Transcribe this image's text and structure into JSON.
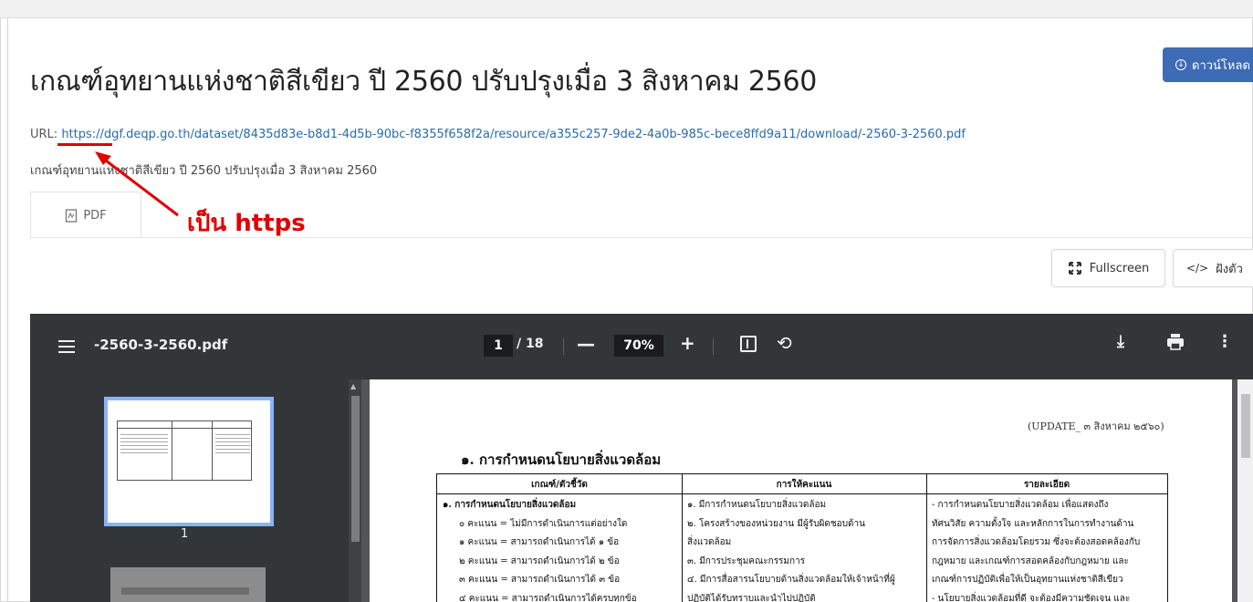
{
  "page": {
    "title": "เกณฑ์อุทยานแห่งชาติสีเขียว ปี 2560 ปรับปรุงเมื่อ 3 สิงหาคม 2560",
    "download_label": "ดาวน์โหลด",
    "url_label": "URL:",
    "url": "https://dgf.deqp.go.th/dataset/8435d83e-b8d1-4d5b-90bc-f8355f658f2a/resource/a355c257-9de2-4a0b-985c-bece8ffd9a11/download/-2560-3-2560.pdf",
    "description": "เกณฑ์อุทยานแห่งชาติสีเขียว ปี 2560 ปรับปรุงเมื่อ 3 สิงหาคม 2560",
    "tab_label": "PDF",
    "fullscreen_label": "Fullscreen",
    "embed_label": "ฝังตัว"
  },
  "annotation": {
    "text": "เป็น https",
    "color": "#e00000"
  },
  "viewer": {
    "filename": "-2560-3-2560.pdf",
    "current_page": "1",
    "total_pages": "/ 18",
    "zoom": "70%",
    "thumbnail_label": "1"
  },
  "document": {
    "update_note": "(UPDATE_ ๓ สิงหาคม ๒๕๖๐)",
    "heading": "๑. การกำหนดนโยบายสิ่งแวดล้อม",
    "table_headers": [
      "เกณฑ์/ตัวชี้วัด",
      "การให้คะแนน",
      "รายละเอียด"
    ],
    "col1": [
      "๑. การกำหนดนโยบายสิ่งแวดล้อม",
      "   ๐ คะแนน = ไม่มีการดำเนินการแต่อย่างใด",
      "   ๑ คะแนน = สามารถดำเนินการได้ ๑ ข้อ",
      "   ๒ คะแนน = สามารถดำเนินการได้ ๒ ข้อ",
      "   ๓ คะแนน = สามารถดำเนินการได้ ๓ ข้อ",
      "   ๔ คะแนน = สามารถดำเนินการได้ครบทุกข้อ"
    ],
    "col2": [
      "๑. มีการกำหนดนโยบายสิ่งแวดล้อม",
      "๒. โครงสร้างของหน่วยงาน มีผู้รับผิดชอบด้าน",
      "สิ่งแวดล้อม",
      "๓. มีการประชุมคณะกรรมการ",
      "๔. มีการสื่อสารนโยบายด้านสิ่งแวดล้อมให้เจ้าหน้าที่ผู้",
      "ปฏิบัติได้รับทราบและนำไปปฏิบัติ"
    ],
    "col3": [
      "- การกำหนดนโยบายสิ่งแวดล้อม เพื่อแสดงถึง",
      "ทัศนวิสัย ความตั้งใจ และหลักการในการทำงานด้าน",
      "การจัดการสิ่งแวดล้อมโดยรวม ซึ่งจะต้องสอดคล้องกับ",
      "กฎหมาย และเกณฑ์การสอดคล้องกับกฎหมาย และ",
      "เกณฑ์การปฏิบัติเพื่อให้เป็นอุทยานแห่งชาติสีเขียว",
      "- นโยบายสิ่งแวดล้อมที่ดี จะต้องมีความชัดเจน และ"
    ]
  }
}
